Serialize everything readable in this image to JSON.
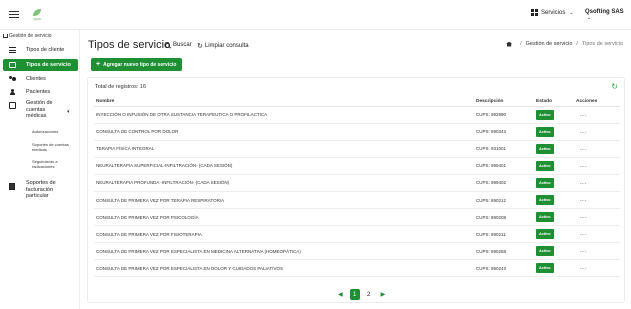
{
  "topbar": {
    "logo_text": "Qsoft",
    "services_label": "Servicios",
    "company_label": "Qsofting SAS"
  },
  "sidebar": {
    "home_label": "Gestión de servicio",
    "items": [
      {
        "label": "Tipos de cliente",
        "icon": "list-icon"
      },
      {
        "label": "Tipos de servicio",
        "icon": "list-box-icon",
        "active": true
      },
      {
        "label": "Clientes",
        "icon": "users-icon"
      },
      {
        "label": "Pacientes",
        "icon": "user-icon"
      }
    ],
    "group": {
      "label": "Gestión de cuentas médicas",
      "subitems": [
        "Autorizaciones",
        "Soportes de cuentas médicas",
        "Seguimiento a radicaciones"
      ]
    },
    "bottom_label": "Soportes de facturación particular"
  },
  "header": {
    "title": "Tipos de servicio",
    "search_label": "Buscar",
    "clear_label": "Limpiar consulta",
    "breadcrumb": [
      "Gestión de servicio",
      "Tipos de servicio"
    ]
  },
  "add_button_label": "Agregar nuevo tipo de servicio",
  "table": {
    "total_label": "Total de registros: 16",
    "columns": [
      "Nombre",
      "Descripción",
      "Estado",
      "Acciones"
    ],
    "rows": [
      {
        "name": "INYECCIÓN O INFUSIÓN DE OTRA SUSTANCIA TERAPEUTICA O PROFILACTICA",
        "desc": "CUPS: 992990",
        "status": "Activo",
        "actions": "..."
      },
      {
        "name": "CONSULTA DE CONTROL POR DOLOR",
        "desc": "CUPS: 890343",
        "status": "Activo",
        "actions": "..."
      },
      {
        "name": "TERAPIA FÍSICA INTEGRAL",
        "desc": "CUPS: 931001",
        "status": "Activo",
        "actions": "..."
      },
      {
        "name": "NEURALTERAPIA SUPERFICIAL-INFILTRACIÓN- (CADA SESIÓN)",
        "desc": "CUPS: 999401",
        "status": "Activo",
        "actions": "..."
      },
      {
        "name": "NEURALTERAPIA PROFUNDA -INFILTRACIÓN- (CADA SESIÓN)",
        "desc": "CUPS: 999402",
        "status": "Activo",
        "actions": "..."
      },
      {
        "name": "CONSULTA DE PRIMERA VEZ POR TERAPIA RESPIRATORIA",
        "desc": "CUPS: 890212",
        "status": "Activo",
        "actions": "..."
      },
      {
        "name": "CONSULTA DE PRIMERA VEZ POR PSICOLOGÍA",
        "desc": "CUPS: 890208",
        "status": "Activo",
        "actions": "..."
      },
      {
        "name": "CONSULTA DE PRIMERA VEZ POR FISIOTERAPIA",
        "desc": "CUPS: 890211",
        "status": "Activo",
        "actions": "..."
      },
      {
        "name": "CONSULTA DE PRIMERA VEZ POR ESPECIALISTA EN MEDICINA ALTERNATIVA (HOMEOPÁTICA)",
        "desc": "CUPS: 890258",
        "status": "Activo",
        "actions": "..."
      },
      {
        "name": "CONSULTA DE PRIMERA VEZ POR ESPECIALISTA EN DOLOR Y CUIDADOS PALIATIVOS",
        "desc": "CUPS: 890243",
        "status": "Activo",
        "actions": "..."
      }
    ]
  },
  "pagination": {
    "pages": [
      "1",
      "2"
    ],
    "current": "1"
  },
  "colors": {
    "accent": "#1f8f34"
  }
}
